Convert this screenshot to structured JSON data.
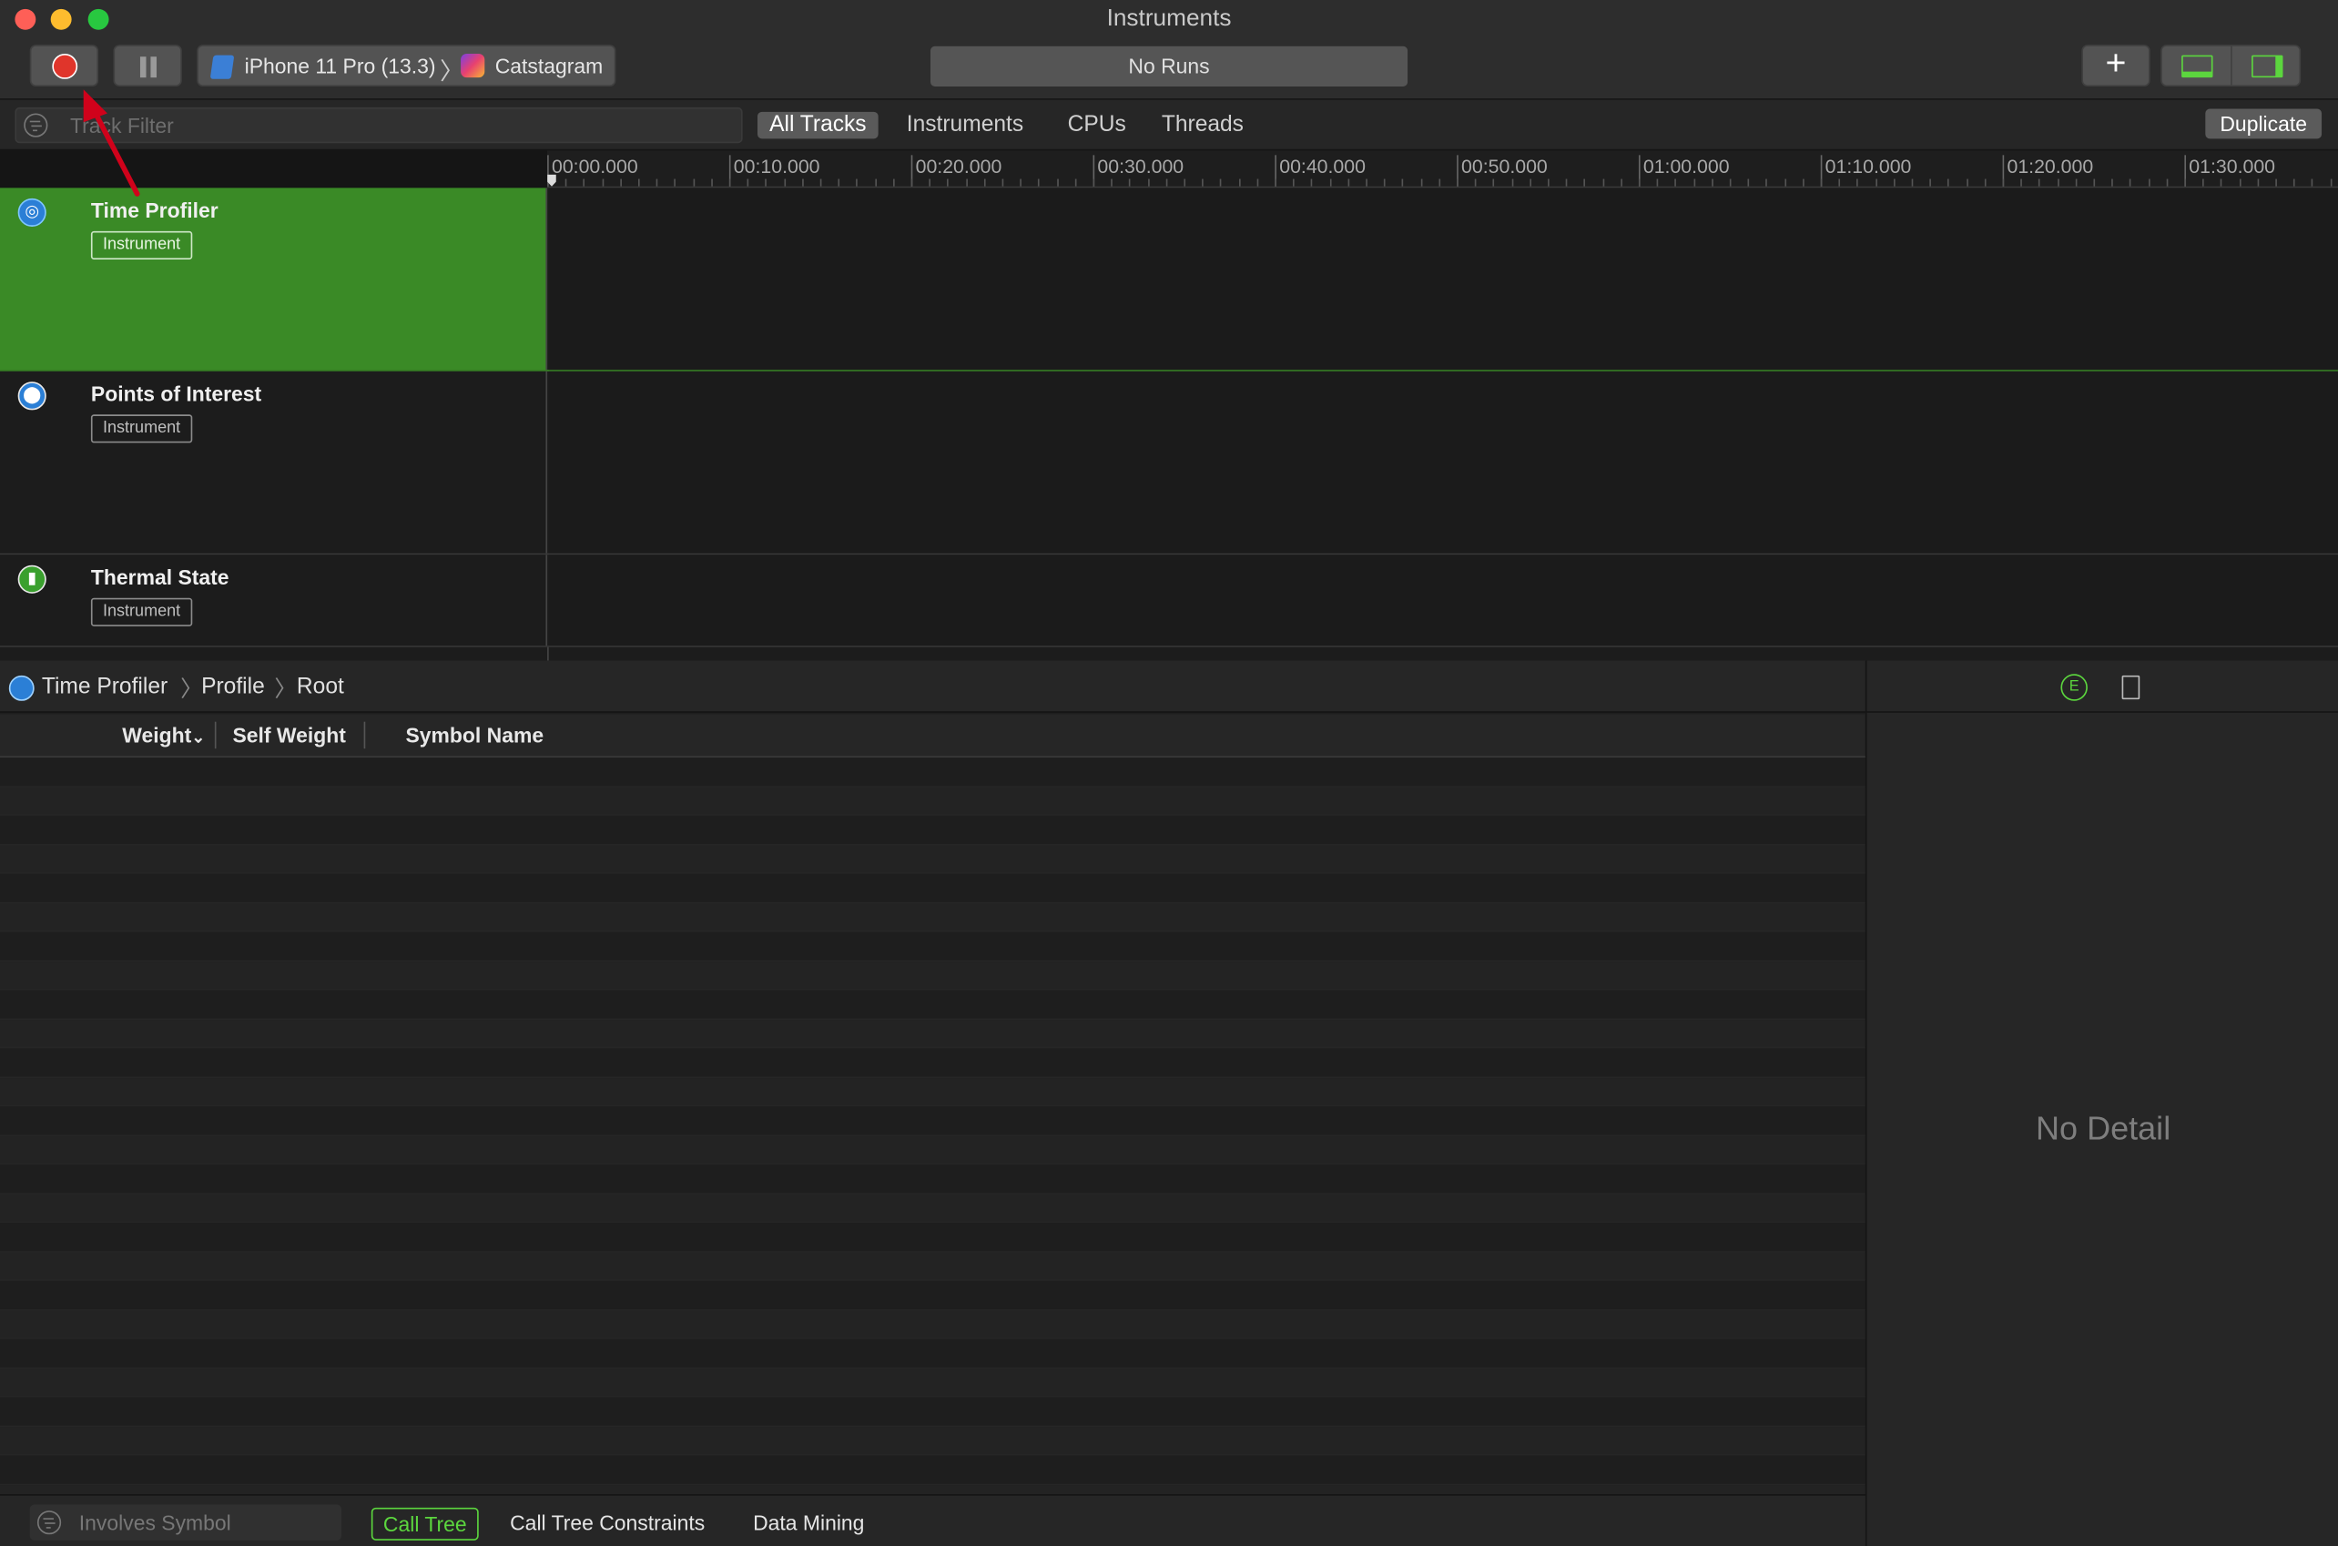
{
  "window": {
    "title": "Instruments"
  },
  "toolbar": {
    "target_device": "iPhone 11 Pro (13.3)",
    "target_app": "Catstagram",
    "runs_label": "No Runs",
    "add_label": "+"
  },
  "filterbar": {
    "track_filter_placeholder": "Track Filter",
    "tabs": [
      "All Tracks",
      "Instruments",
      "CPUs",
      "Threads"
    ],
    "active_tab": "All Tracks",
    "duplicate_label": "Duplicate"
  },
  "timeline": {
    "ticks": [
      "00:00.000",
      "00:10.000",
      "00:20.000",
      "00:30.000",
      "00:40.000",
      "00:50.000",
      "01:00.000",
      "01:10.000",
      "01:20.000",
      "01:30.000"
    ]
  },
  "tracks": [
    {
      "name": "Time Profiler",
      "badge": "Instrument",
      "icon": "time-profiler-icon",
      "selected": true
    },
    {
      "name": "Points of Interest",
      "badge": "Instrument",
      "icon": "points-of-interest-icon",
      "selected": false
    },
    {
      "name": "Thermal State",
      "badge": "Instrument",
      "icon": "thermal-state-icon",
      "selected": false
    }
  ],
  "detail_breadcrumb": [
    "Time Profiler",
    "Profile",
    "Root"
  ],
  "columns": {
    "weight": "Weight",
    "self_weight": "Self Weight",
    "symbol_name": "Symbol Name"
  },
  "detail_panel": {
    "empty_text": "No Detail"
  },
  "bottom_bar": {
    "symbol_filter_placeholder": "Involves Symbol",
    "tabs": [
      "Call Tree",
      "Call Tree Constraints",
      "Data Mining"
    ],
    "active_tab": "Call Tree"
  },
  "colors": {
    "selected_track": "#3a8a26",
    "accent_green": "#5cd63e",
    "record_red": "#e0352b",
    "annotation_arrow": "#d0021b"
  }
}
